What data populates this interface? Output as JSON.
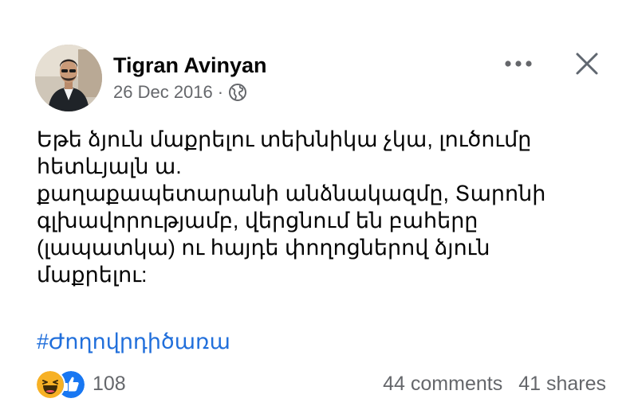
{
  "post": {
    "author": "Tigran Avinyan",
    "date": "26 Dec 2016",
    "separator": "·",
    "audience_icon": "globe-icon",
    "body_lines": [
      "Եթե ձյուն մաքրելու տեխնիկա չկա, լուծումը",
      "հետևյալն ա.",
      "քաղաքապետարանի անձնակազմը, Տարոնի",
      "գլխավորությամբ, վերցնում են բահերը",
      "(լապատկա) ու հայդե փողոցներով ձյուն",
      "մաքրելու:"
    ],
    "hashtag": "#Ժողովրդիծառա"
  },
  "footer": {
    "reaction_icons": [
      "haha-icon",
      "like-icon"
    ],
    "reaction_count": "108",
    "comments": "44 comments",
    "shares": "41 shares"
  },
  "colors": {
    "hashtag": "#216fdb",
    "secondary_text": "#65676b",
    "like_blue": "#1877f2",
    "haha_yellow": "#f7b125"
  }
}
